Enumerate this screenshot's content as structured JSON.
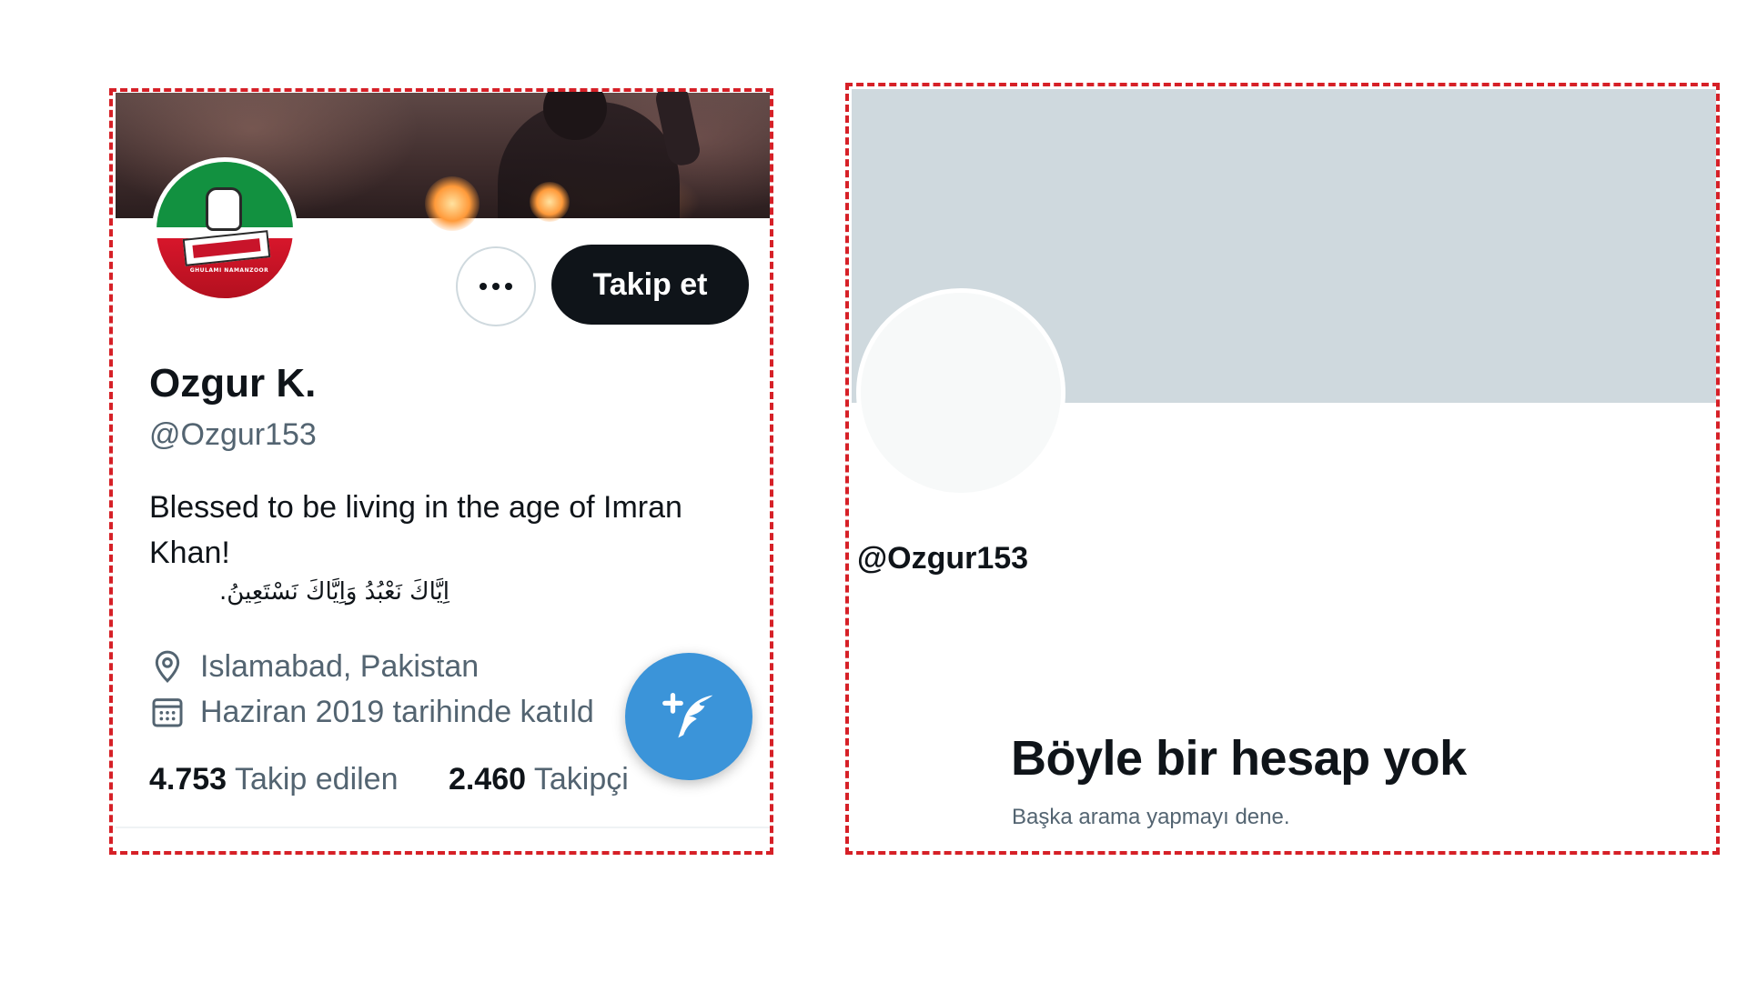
{
  "left_profile": {
    "follow_label": "Takip et",
    "display_name": "Ozgur K.",
    "handle": "@Ozgur153",
    "bio": "Blessed to be living in the age of Imran Khan!",
    "bio_arabic": "اِيَّاكَ نَعْبُدُ وَاِيَّاكَ نَسْتَعِينُ.",
    "location": "Islamabad, Pakistan",
    "joined": "Haziran 2019 tarihinde katıld",
    "following_count": "4.753",
    "following_label": "Takip edilen",
    "followers_count": "2.460",
    "followers_label": "Takipçi",
    "avatar_caption": "GHULAMI NAMANZOOR"
  },
  "right_profile": {
    "handle": "@Ozgur153",
    "title": "Böyle bir hesap yok",
    "subtitle": "Başka arama yapmayı dene."
  },
  "icons": {
    "more": "more-icon",
    "location": "map-pin-icon",
    "calendar": "calendar-icon",
    "compose": "compose-tweet-icon"
  },
  "colors": {
    "frame_dash": "#d62027",
    "follow_button": "#0f1419",
    "compose_button": "#3b94d9",
    "secondary_text": "#536471",
    "empty_banner": "#cfd9de"
  }
}
